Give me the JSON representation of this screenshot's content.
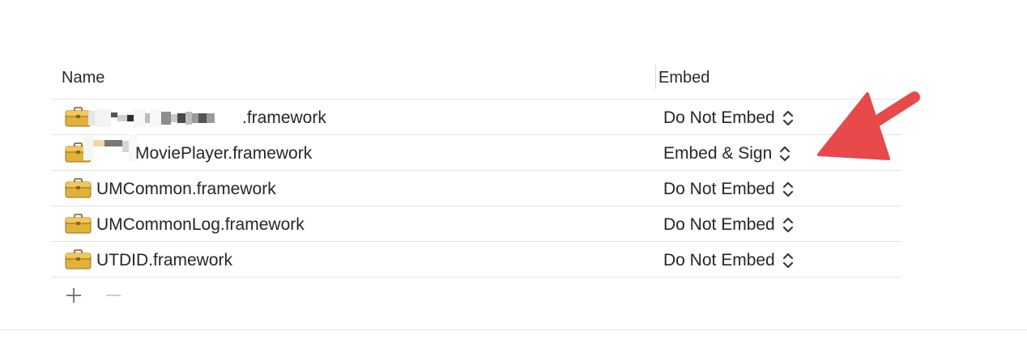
{
  "table": {
    "columns": {
      "name": "Name",
      "embed": "Embed"
    },
    "rows": [
      {
        "name": ".framework",
        "embed": "Do Not Embed",
        "name_redacted": true,
        "icon": "toolbox-icon"
      },
      {
        "name": "MoviePlayer.framework",
        "embed": "Embed & Sign",
        "name_redacted": true,
        "icon": "toolbox-icon"
      },
      {
        "name": "UMCommon.framework",
        "embed": "Do Not Embed",
        "icon": "toolbox-icon"
      },
      {
        "name": "UMCommonLog.framework",
        "embed": "Do Not Embed",
        "icon": "toolbox-icon"
      },
      {
        "name": "UTDID.framework",
        "embed": "Do Not Embed",
        "icon": "toolbox-icon"
      }
    ]
  },
  "controls": {
    "add_icon": "plus-icon",
    "remove_icon": "minus-icon"
  },
  "annotation": {
    "icon": "red-arrow-icon",
    "color": "#e8494a"
  }
}
